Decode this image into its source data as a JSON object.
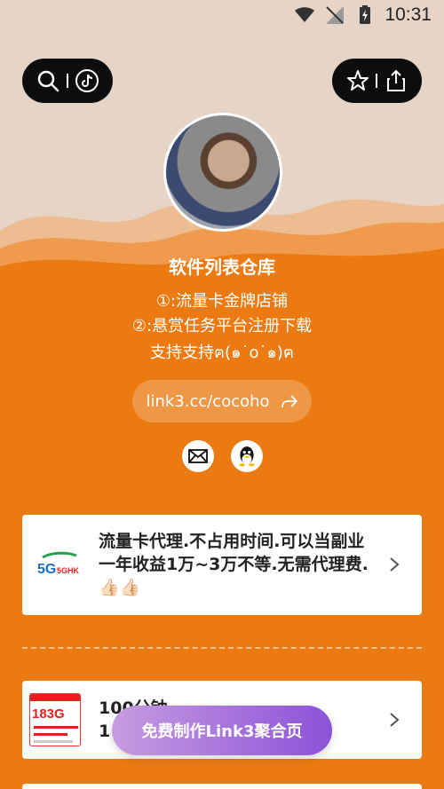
{
  "status_bar": {
    "time": "10:31"
  },
  "profile": {
    "title": "软件列表仓库",
    "lines": [
      "①:流量卡金牌店铺",
      "②:悬赏任务平台注册下载",
      "支持支持ฅ(๑˙o˙๑)ฅ"
    ],
    "link": "link3.cc/cocoho"
  },
  "cards": [
    {
      "text": "流量卡代理.不占用时间.可以当副业一年收益1万~3万不等.无需代理费.👍🏻👍🏻",
      "logo": "5GHK"
    },
    {
      "text_line1": "100分钟",
      "text_line2": "1",
      "thumb_big": "183G"
    }
  ],
  "cta": {
    "label": "免费制作Link3聚合页"
  },
  "icons": {
    "top_left": [
      "search-icon",
      "tiktok-icon"
    ],
    "top_right": [
      "star-icon",
      "share-icon"
    ],
    "social": [
      "mail-icon",
      "qq-icon"
    ]
  },
  "colors": {
    "accent": "#ec7a12",
    "hero": "#e6d5c7",
    "cta_start": "#c89be0",
    "cta_end": "#8b52d8"
  }
}
